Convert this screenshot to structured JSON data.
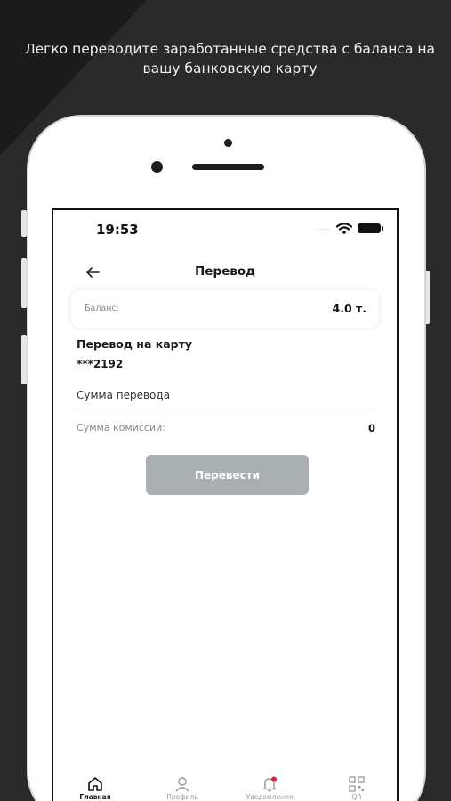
{
  "promo_text": "Легко переводите заработанные средства с баланса на вашу банковскую карту",
  "status_bar": {
    "time": "19:53",
    "signal_dots": "····"
  },
  "header": {
    "title": "Перевод"
  },
  "balance": {
    "label": "Баланс:",
    "value": "4.0 т."
  },
  "card": {
    "label": "Перевод на карту",
    "number": "***2192"
  },
  "amount": {
    "placeholder": "Сумма перевода"
  },
  "fee": {
    "label": "Сумма комиссии:",
    "value": "0"
  },
  "transfer_button": {
    "label": "Перевести",
    "enabled": false,
    "color": "#aab0b1"
  },
  "tabbar": {
    "items": [
      {
        "label": "Главная",
        "icon": "home-icon",
        "active": true
      },
      {
        "label": "Профиль",
        "icon": "profile-icon",
        "active": false
      },
      {
        "label": "Уведомления",
        "icon": "bell-icon",
        "active": false,
        "badge": true
      },
      {
        "label": "QR",
        "icon": "qr-icon",
        "active": false
      }
    ]
  },
  "colors": {
    "background": "#2a2a2a",
    "badge": "#e0202e",
    "text": "#1a1a1a"
  }
}
